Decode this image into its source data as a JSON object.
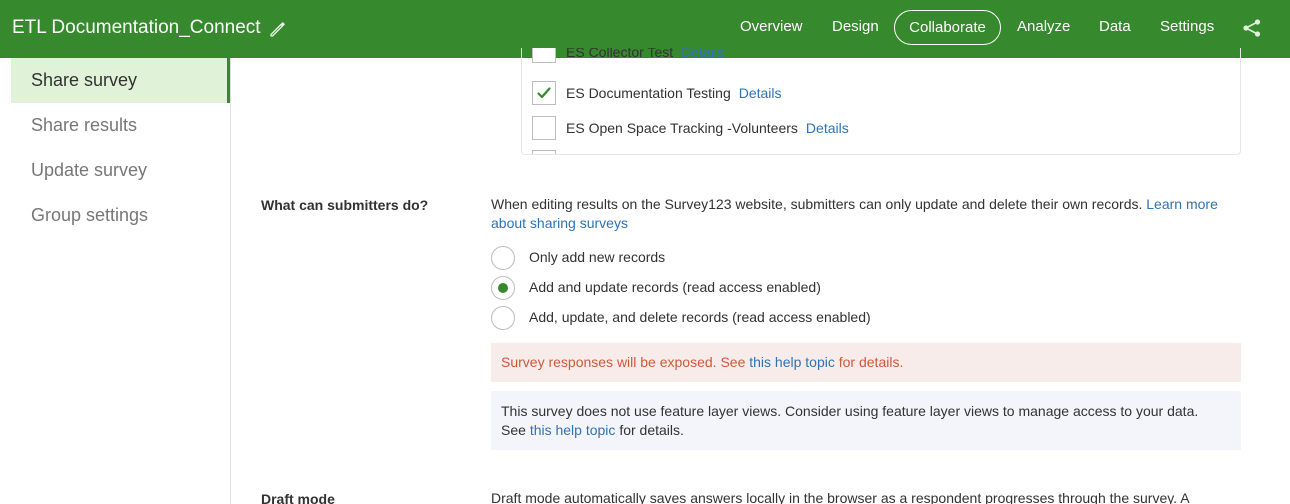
{
  "header": {
    "title": "ETL Documentation_Connect",
    "nav": [
      "Overview",
      "Design",
      "Collaborate",
      "Analyze",
      "Data",
      "Settings"
    ],
    "active_nav": "Collaborate",
    "accent": "#36892d"
  },
  "sidebar": {
    "items": [
      {
        "label": "Share survey",
        "active": true
      },
      {
        "label": "Share results",
        "active": false
      },
      {
        "label": "Update survey",
        "active": false
      },
      {
        "label": "Group settings",
        "active": false
      }
    ]
  },
  "groups": {
    "rows": [
      {
        "name": "ES Collector Test",
        "details": "Details",
        "checked": false
      },
      {
        "name": "ES Documentation Testing",
        "details": "Details",
        "checked": true
      },
      {
        "name": "ES Open Space Tracking -Volunteers",
        "details": "Details",
        "checked": false
      }
    ]
  },
  "submitters": {
    "label": "What can submitters do?",
    "desc": "When editing results on the Survey123 website, submitters can only update and delete their own records.",
    "learn_more_1": "Learn more",
    "learn_more_2": "about sharing surveys",
    "options": [
      {
        "label": "Only add new records",
        "selected": false
      },
      {
        "label": "Add and update records (read access enabled)",
        "selected": true
      },
      {
        "label": "Add, update, and delete records (read access enabled)",
        "selected": false
      }
    ],
    "warning_prefix": "Survey responses will be exposed. See",
    "warning_link": "this help topic",
    "warning_suffix": "for details.",
    "info_line1": "This survey does not use feature layer views. Consider using feature layer views to manage access to your data.",
    "info_prefix": "See",
    "info_link": "this help topic",
    "info_suffix": "for details."
  },
  "draft": {
    "label": "Draft mode",
    "desc": "Draft mode automatically saves answers locally in the browser as a respondent progresses through the survey. A"
  }
}
